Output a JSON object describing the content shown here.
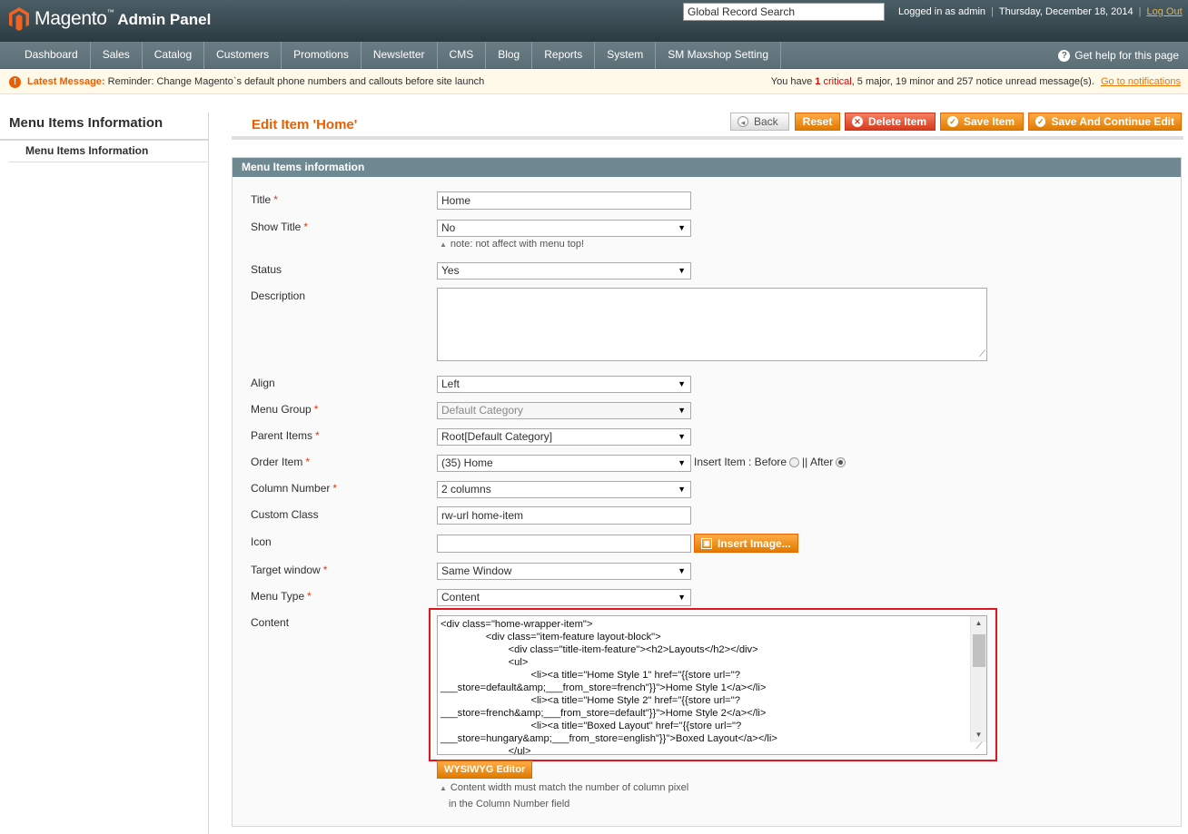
{
  "header": {
    "brand": "Magento",
    "brand_suffix": "Admin Panel",
    "search_value": "Global Record Search",
    "logged_in": "Logged in as admin",
    "date": "Thursday, December 18, 2014",
    "logout": "Log Out"
  },
  "nav": {
    "items": [
      "Dashboard",
      "Sales",
      "Catalog",
      "Customers",
      "Promotions",
      "Newsletter",
      "CMS",
      "Blog",
      "Reports",
      "System",
      "SM Maxshop Setting"
    ],
    "help": "Get help for this page"
  },
  "message": {
    "label": "Latest Message:",
    "text": "Reminder: Change Magento`s default phone numbers and callouts before site launch",
    "summary_prefix": "You have",
    "critical_count": "1",
    "critical_word": "critical",
    "major": ", 5 major, ",
    "minor": "19 minor and ",
    "notice": "257 notice unread message(s).",
    "link": "Go to notifications"
  },
  "sidebar": {
    "title": "Menu Items Information",
    "tab": "Menu Items Information"
  },
  "page": {
    "title": "Edit Item 'Home'",
    "buttons": {
      "back": "Back",
      "reset": "Reset",
      "delete": "Delete Item",
      "save": "Save Item",
      "save_continue": "Save And Continue Edit"
    }
  },
  "form": {
    "legend": "Menu Items information",
    "labels": {
      "title": "Title",
      "show_title": "Show Title",
      "status": "Status",
      "description": "Description",
      "align": "Align",
      "menu_group": "Menu Group",
      "parent_items": "Parent Items",
      "order_item": "Order Item",
      "column_number": "Column Number",
      "custom_class": "Custom Class",
      "icon": "Icon",
      "target_window": "Target window",
      "menu_type": "Menu Type",
      "content": "Content"
    },
    "required": "*",
    "values": {
      "title": "Home",
      "show_title": "No",
      "status": "Yes",
      "align": "Left",
      "menu_group": "Default Category",
      "parent_items": "Root[Default Category]",
      "order_item": "(35) Home",
      "column_number": "2 columns",
      "custom_class": "rw-url home-item",
      "target_window": "Same Window",
      "menu_type": "Content"
    },
    "show_title_note": "note: not affect with menu top!",
    "insert_item": "Insert Item : Before",
    "insert_sep": "|| After",
    "insert_image": "Insert Image...",
    "content_code": "<div class=\"home-wrapper-item\">\n\t\t<div class=\"item-feature layout-block\">\n\t\t\t<div class=\"title-item-feature\"><h2>Layouts</h2></div>\n\t\t\t<ul>\n\t\t\t\t<li><a title=\"Home Style 1\" href=\"{{store url=\"?\n___store=default&amp;___from_store=french\"}}\">Home Style 1</a></li>\n\t\t\t\t<li><a title=\"Home Style 2\" href=\"{{store url=\"?\n___store=french&amp;___from_store=default\"}}\">Home Style 2</a></li>\n\t\t\t\t<li><a title=\"Boxed Layout\" href=\"{{store url=\"?\n___store=hungary&amp;___from_store=english\"}}\">Boxed Layout</a></li>\n\t\t\t</ul>",
    "wysiwyg": "WYSIWYG Editor",
    "content_note_1": "Content width must match the number of column pixel",
    "content_note_2": "in the Column Number field"
  }
}
